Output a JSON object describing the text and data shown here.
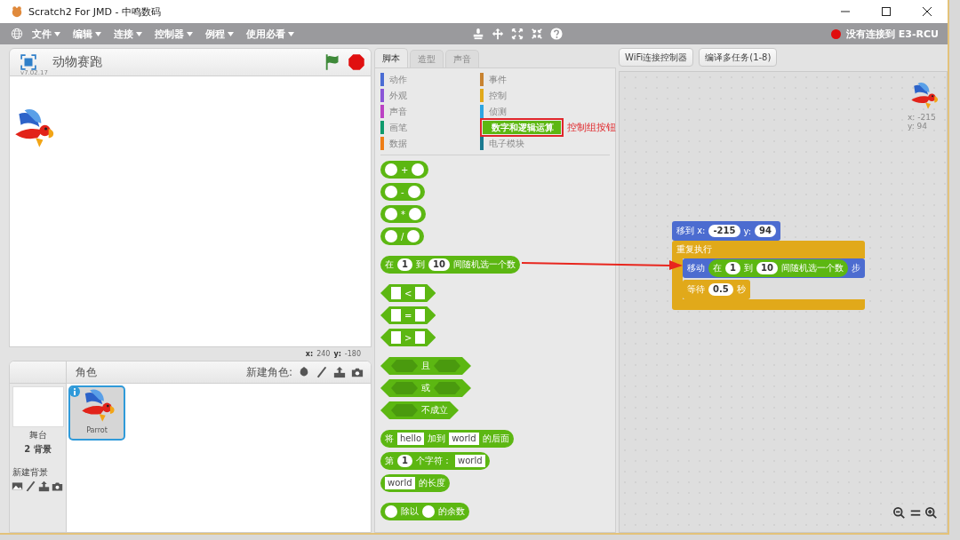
{
  "window": {
    "title": "Scratch2 For JMD - 中鸣数码"
  },
  "menu": [
    {
      "label": "文件"
    },
    {
      "label": "编辑"
    },
    {
      "label": "连接"
    },
    {
      "label": "控制器"
    },
    {
      "label": "例程"
    },
    {
      "label": "使用必看"
    }
  ],
  "connection": {
    "status": "没有连接到 E3-RCU",
    "connected": false
  },
  "stage": {
    "title": "动物赛跑",
    "version": "v7.02.17",
    "x_label": "x:",
    "x_value": "240",
    "y_label": "y:",
    "y_value": "-180"
  },
  "tabs": [
    {
      "label": "脚本",
      "selected": true
    },
    {
      "label": "造型",
      "selected": false
    },
    {
      "label": "声音",
      "selected": false
    }
  ],
  "categories": [
    {
      "label": "动作",
      "color": "#4a6cd4",
      "selected": false
    },
    {
      "label": "事件",
      "color": "#c88330",
      "selected": false
    },
    {
      "label": "外观",
      "color": "#8a55d7",
      "selected": false
    },
    {
      "label": "控制",
      "color": "#e1a91a",
      "selected": false
    },
    {
      "label": "声音",
      "color": "#bb42c3",
      "selected": false
    },
    {
      "label": "侦测",
      "color": "#2ca5e2",
      "selected": false
    },
    {
      "label": "画笔",
      "color": "#0e9a6c",
      "selected": false
    },
    {
      "label": "数字和逻辑运算",
      "color": "#5cb712",
      "selected": true,
      "annotation": "控制组按钮"
    },
    {
      "label": "数据",
      "color": "#ee7d16",
      "selected": false
    },
    {
      "label": "电子模块",
      "color": "#1a7a90",
      "selected": false
    }
  ],
  "palette_groups": [
    {
      "blocks": [
        {
          "kind": "reporter",
          "parts": [
            {
              "kind": "round"
            },
            {
              "kind": "label",
              "text": "+"
            },
            {
              "kind": "round"
            }
          ]
        },
        {
          "kind": "reporter",
          "parts": [
            {
              "kind": "round"
            },
            {
              "kind": "label",
              "text": "-"
            },
            {
              "kind": "round"
            }
          ]
        },
        {
          "kind": "reporter",
          "parts": [
            {
              "kind": "round"
            },
            {
              "kind": "label",
              "text": "*"
            },
            {
              "kind": "round"
            }
          ]
        },
        {
          "kind": "reporter",
          "parts": [
            {
              "kind": "round"
            },
            {
              "kind": "label",
              "text": "/"
            },
            {
              "kind": "round"
            }
          ]
        }
      ]
    },
    {
      "blocks": [
        {
          "kind": "reporter",
          "parts": [
            {
              "kind": "label",
              "text": "在"
            },
            {
              "kind": "num",
              "text": "1"
            },
            {
              "kind": "label",
              "text": "到"
            },
            {
              "kind": "num",
              "text": "10"
            },
            {
              "kind": "label",
              "text": "间随机选一个数"
            }
          ]
        }
      ]
    },
    {
      "blocks": [
        {
          "kind": "boolean",
          "parts": [
            {
              "kind": "square"
            },
            {
              "kind": "label",
              "text": "<"
            },
            {
              "kind": "square"
            }
          ]
        },
        {
          "kind": "boolean",
          "parts": [
            {
              "kind": "square"
            },
            {
              "kind": "label",
              "text": "="
            },
            {
              "kind": "square"
            }
          ]
        },
        {
          "kind": "boolean",
          "parts": [
            {
              "kind": "square"
            },
            {
              "kind": "label",
              "text": ">"
            },
            {
              "kind": "square"
            }
          ]
        }
      ]
    },
    {
      "blocks": [
        {
          "kind": "boolean",
          "parts": [
            {
              "kind": "hex"
            },
            {
              "kind": "label",
              "text": "且"
            },
            {
              "kind": "hex"
            }
          ]
        },
        {
          "kind": "boolean",
          "parts": [
            {
              "kind": "hex"
            },
            {
              "kind": "label",
              "text": "或"
            },
            {
              "kind": "hex"
            }
          ]
        },
        {
          "kind": "boolean",
          "parts": [
            {
              "kind": "hex"
            },
            {
              "kind": "label",
              "text": "不成立"
            }
          ]
        }
      ]
    },
    {
      "blocks": [
        {
          "kind": "reporter",
          "parts": [
            {
              "kind": "label",
              "text": "将"
            },
            {
              "kind": "str",
              "text": "hello"
            },
            {
              "kind": "label",
              "text": "加到"
            },
            {
              "kind": "str",
              "text": "world"
            },
            {
              "kind": "label",
              "text": "的后面"
            }
          ]
        },
        {
          "kind": "reporter",
          "parts": [
            {
              "kind": "label",
              "text": "第"
            },
            {
              "kind": "num",
              "text": "1"
            },
            {
              "kind": "label",
              "text": "个字符："
            },
            {
              "kind": "str",
              "text": "world"
            }
          ]
        },
        {
          "kind": "reporter",
          "parts": [
            {
              "kind": "str",
              "text": "world"
            },
            {
              "kind": "label",
              "text": "的长度"
            }
          ]
        }
      ]
    },
    {
      "blocks": [
        {
          "kind": "reporter",
          "parts": [
            {
              "kind": "round"
            },
            {
              "kind": "label",
              "text": "除以"
            },
            {
              "kind": "round"
            },
            {
              "kind": "label",
              "text": "的余数"
            }
          ]
        }
      ]
    }
  ],
  "toolbar_buttons": [
    {
      "label": "WiFi连接控制器"
    },
    {
      "label": "编译多任务(1-8)"
    }
  ],
  "sprite_info": {
    "x": "x: -215",
    "y": "y: 94"
  },
  "script": [
    {
      "color": "#4c6cd0",
      "kind": "command",
      "parts": [
        {
          "kind": "label",
          "text": "移到 x:"
        },
        {
          "kind": "num",
          "text": "-215"
        },
        {
          "kind": "label",
          "text": "y:"
        },
        {
          "kind": "num",
          "text": "94"
        }
      ]
    },
    {
      "color": "#e1a91a",
      "kind": "c",
      "parts": [
        {
          "kind": "label",
          "text": "重复执行"
        }
      ],
      "children": [
        {
          "color": "#4c6cd0",
          "kind": "command",
          "parts": [
            {
              "kind": "label",
              "text": "移动"
            },
            {
              "kind": "reporter",
              "parts": [
                {
                  "kind": "label",
                  "text": "在"
                },
                {
                  "kind": "num",
                  "text": "1"
                },
                {
                  "kind": "label",
                  "text": "到"
                },
                {
                  "kind": "num",
                  "text": "10"
                },
                {
                  "kind": "label",
                  "text": "间随机选一个数"
                }
              ]
            },
            {
              "kind": "label",
              "text": "步"
            }
          ]
        },
        {
          "color": "#e1a91a",
          "kind": "command",
          "parts": [
            {
              "kind": "label",
              "text": "等待"
            },
            {
              "kind": "num",
              "text": "0.5"
            },
            {
              "kind": "label",
              "text": "秒"
            }
          ]
        }
      ]
    }
  ],
  "sprites_panel": {
    "title": "角色",
    "new_sprite_label": "新建角色:",
    "stage_label": "舞台",
    "backdrop_count": "2 背景",
    "new_backdrop_label": "新建背景",
    "sprites": [
      {
        "name": "Parrot",
        "selected": true
      }
    ]
  }
}
